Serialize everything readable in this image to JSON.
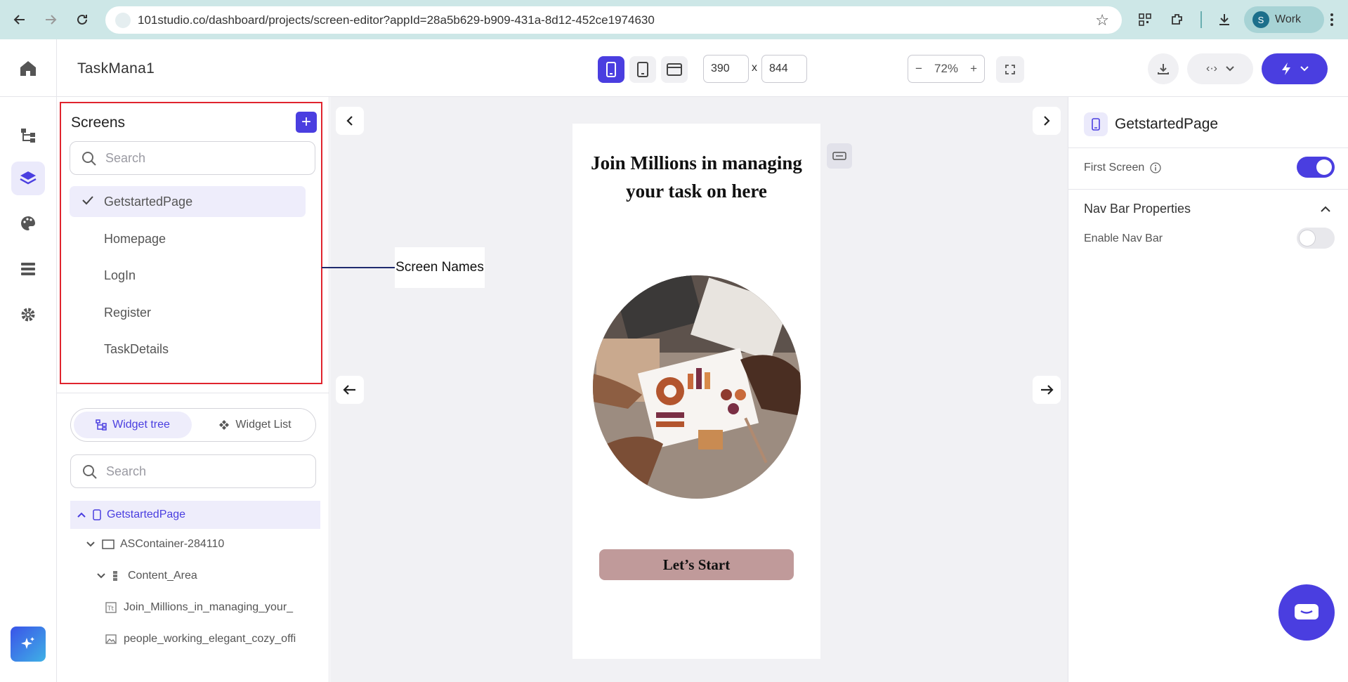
{
  "browser": {
    "url": "101studio.co/dashboard/projects/screen-editor?appId=28a5b629-b909-431a-8d12-452ce1974630",
    "profile_initial": "S",
    "profile_label": "Work"
  },
  "app": {
    "title": "TaskMana1",
    "width_value": "390",
    "height_value": "844",
    "dim_separator": "x",
    "zoom": "72%"
  },
  "screens": {
    "title": "Screens",
    "search_placeholder": "Search",
    "items": [
      {
        "label": "GetstartedPage"
      },
      {
        "label": "Homepage"
      },
      {
        "label": "LogIn"
      },
      {
        "label": "Register"
      },
      {
        "label": "TaskDetails"
      }
    ]
  },
  "widgets": {
    "tab_tree": "Widget tree",
    "tab_list": "Widget List",
    "search_placeholder": "Search",
    "tree": [
      {
        "label": "GetstartedPage"
      },
      {
        "label": "ASContainer-284110"
      },
      {
        "label": "Content_Area"
      },
      {
        "label": "Join_Millions_in_managing_your_"
      },
      {
        "label": "people_working_elegant_cozy_offi"
      }
    ]
  },
  "canvas": {
    "callout": "Screen Names",
    "phone_heading": "Join Millions in managing your task on here",
    "phone_button": "Let’s Start"
  },
  "properties": {
    "page_name": "GetstartedPage",
    "first_screen_label": "First Screen",
    "first_screen_on": true,
    "nav_section": "Nav Bar Properties",
    "enable_nav_label": "Enable Nav Bar",
    "enable_nav_on": false
  },
  "colors": {
    "accent": "#4a3ee0",
    "highlight_border": "#e0242e",
    "phone_button": "#c09a9a"
  }
}
